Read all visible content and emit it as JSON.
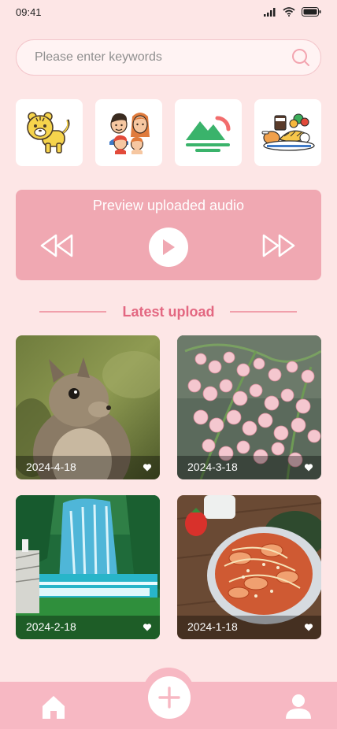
{
  "status_bar": {
    "time": "09:41"
  },
  "search": {
    "placeholder": "Please enter keywords",
    "value": "",
    "icon": "search-icon"
  },
  "categories": [
    {
      "icon": "tiger-icon"
    },
    {
      "icon": "family-icon"
    },
    {
      "icon": "mountain-sun-icon"
    },
    {
      "icon": "food-icon"
    }
  ],
  "audio": {
    "title": "Preview uploaded audio",
    "controls": [
      "rewind-icon",
      "play-icon",
      "fast-forward-icon"
    ]
  },
  "section": {
    "title": "Latest upload"
  },
  "gallery": [
    {
      "date": "2024-4-18",
      "subject": "squirrel",
      "icon": "heart-icon"
    },
    {
      "date": "2024-3-18",
      "subject": "lily-of-the-valley",
      "icon": "heart-icon"
    },
    {
      "date": "2024-2-18",
      "subject": "waterfall",
      "icon": "heart-icon"
    },
    {
      "date": "2024-1-18",
      "subject": "shrimp-pasta",
      "icon": "heart-icon"
    }
  ],
  "bottom_nav": {
    "items": [
      "home-icon",
      "add-icon",
      "profile-icon"
    ]
  },
  "colors": {
    "background": "#fde6e6",
    "accent": "#e36781",
    "audio_card": "#f0a8b2",
    "nav": "#f7b8c3"
  }
}
